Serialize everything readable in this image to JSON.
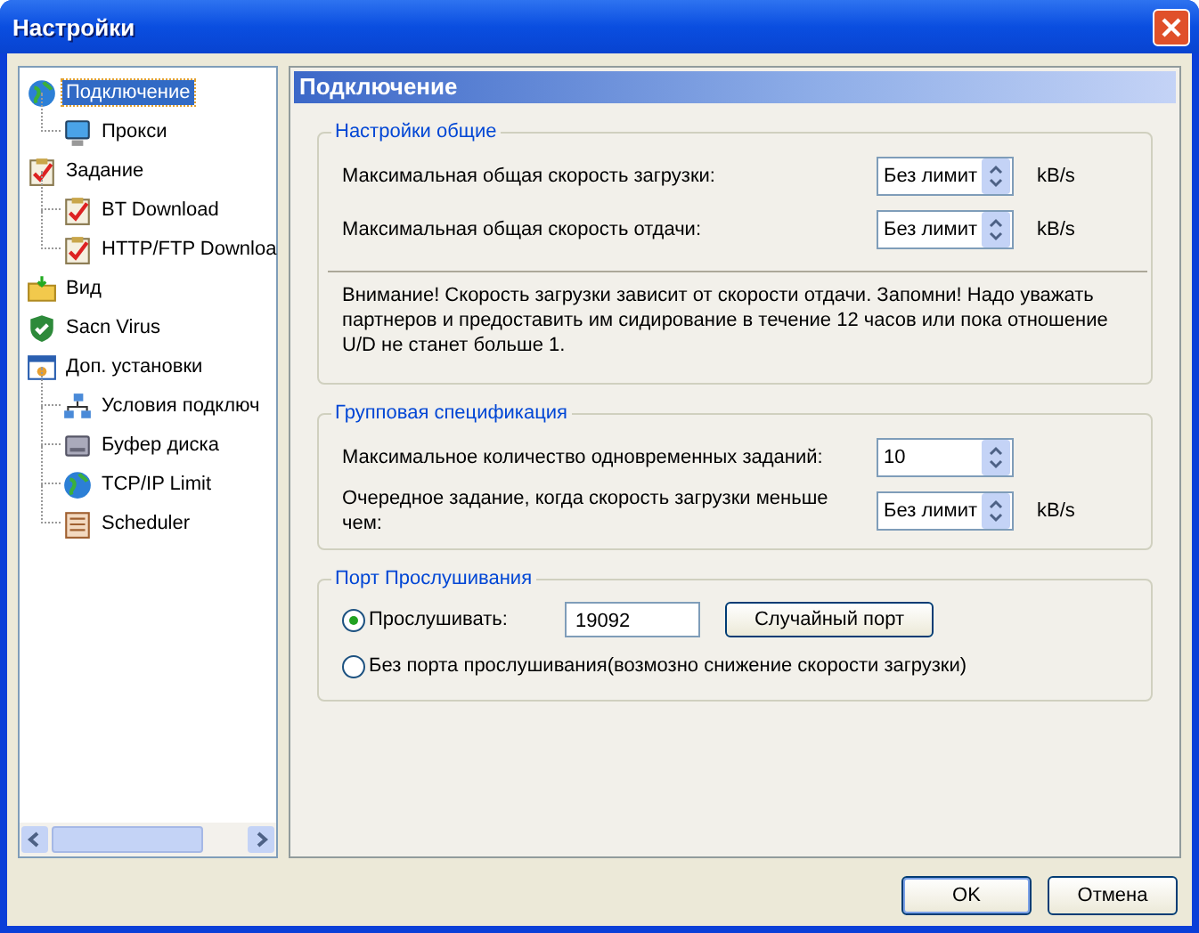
{
  "window": {
    "title": "Настройки"
  },
  "tree": [
    {
      "label": "Подключение",
      "selected": true,
      "children": [
        {
          "label": "Прокси",
          "selected": false
        }
      ]
    },
    {
      "label": "Задание",
      "selected": false,
      "children": [
        {
          "label": "BT Download",
          "selected": false
        },
        {
          "label": "HTTP/FTP Downloa",
          "selected": false
        }
      ]
    },
    {
      "label": "Вид",
      "selected": false
    },
    {
      "label": "Sacn Virus",
      "selected": false
    },
    {
      "label": "Доп. установки",
      "selected": false,
      "children": [
        {
          "label": "Условия подключ",
          "selected": false
        },
        {
          "label": "Буфер диска",
          "selected": false
        },
        {
          "label": "TCP/IP Limit",
          "selected": false
        },
        {
          "label": "Scheduler",
          "selected": false
        }
      ]
    }
  ],
  "panel": {
    "title": "Подключение",
    "general": {
      "title": "Настройки общие",
      "rows": [
        {
          "label": "Максимальная общая скорость загрузки:",
          "value": "Без лимит",
          "unit": "kB/s"
        },
        {
          "label": "Максимальная общая скорость отдачи:",
          "value": "Без лимит",
          "unit": "kB/s"
        }
      ],
      "note": "Внимание! Скорость загрузки зависит от скорости отдачи. Запомни! Надо уважать партнеров и предоставить им сидирование в течение 12 часов или пока отношение U/D не станет больше 1."
    },
    "group": {
      "title": "Групповая спецификация",
      "rows": [
        {
          "label": "Максимальное количество одновременных заданий:",
          "value": "10"
        },
        {
          "label": "Очередное задание, когда скорость загрузки меньше чем:",
          "value": "Без лимит",
          "unit": "kB/s"
        }
      ]
    },
    "port": {
      "title": "Порт Прослушивания",
      "options": [
        {
          "label": "Прослушивать:",
          "selected": true,
          "value": "19092",
          "button": "Случайный порт"
        },
        {
          "label": "Без порта прослушивания(возмозно снижение скорости загрузки)",
          "selected": false
        }
      ]
    }
  },
  "buttons": [
    "OK",
    "Отмена"
  ]
}
